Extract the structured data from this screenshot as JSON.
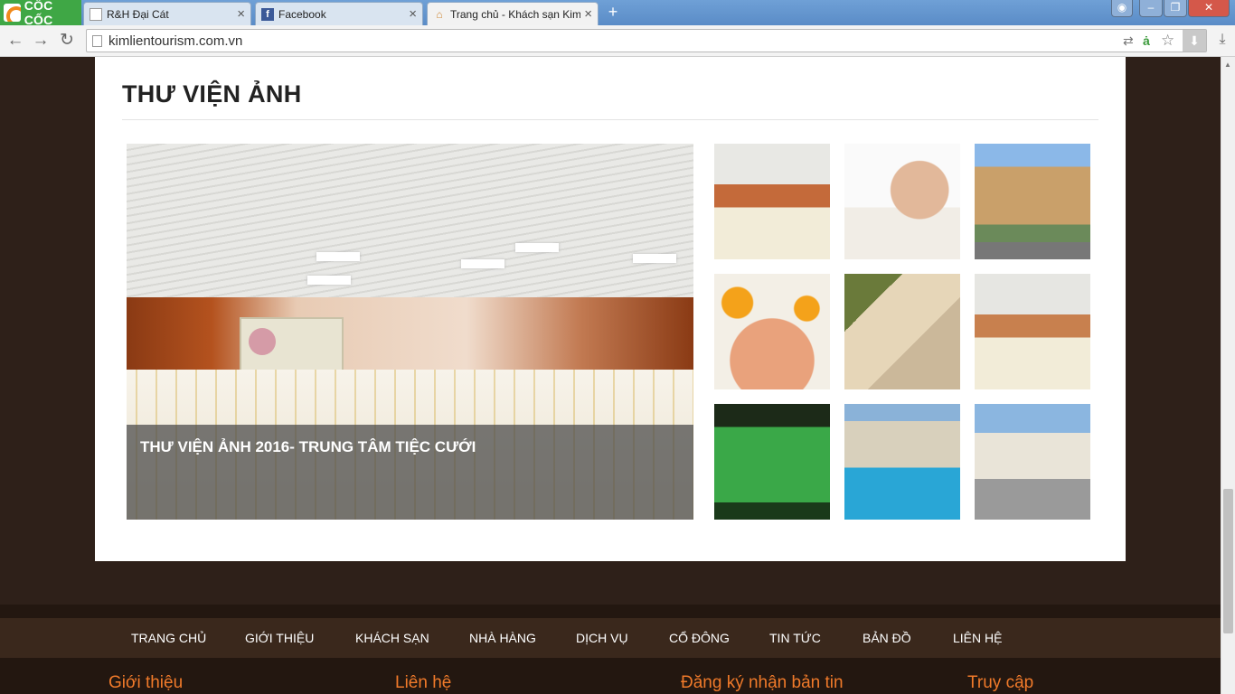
{
  "browser": {
    "brand": "CỐC CỐC",
    "tabs": [
      {
        "title": "R&H Đại Cát",
        "icon": "document-icon"
      },
      {
        "title": "Facebook",
        "icon": "facebook-icon"
      },
      {
        "title": "Trang chủ - Khách sạn Kim",
        "icon": "home-icon"
      }
    ],
    "url": "kimlientourism.com.vn"
  },
  "gallery": {
    "title": "THƯ VIỆN ẢNH",
    "feature_caption": "THƯ VIỆN ẢNH 2016- TRUNG TÂM TIỆC CƯỚI"
  },
  "footer": {
    "nav": [
      "TRANG CHỦ",
      "GIỚI THIỆU",
      "KHÁCH SẠN",
      "NHÀ HÀNG",
      "DỊCH VỤ",
      "CỔ ĐÔNG",
      "TIN TỨC",
      "BẢN ĐỒ",
      "LIÊN HỆ"
    ],
    "headings": [
      "Giới thiệu",
      "Liên hệ",
      "Đăng ký nhận bản tin",
      "Truy cập"
    ]
  }
}
